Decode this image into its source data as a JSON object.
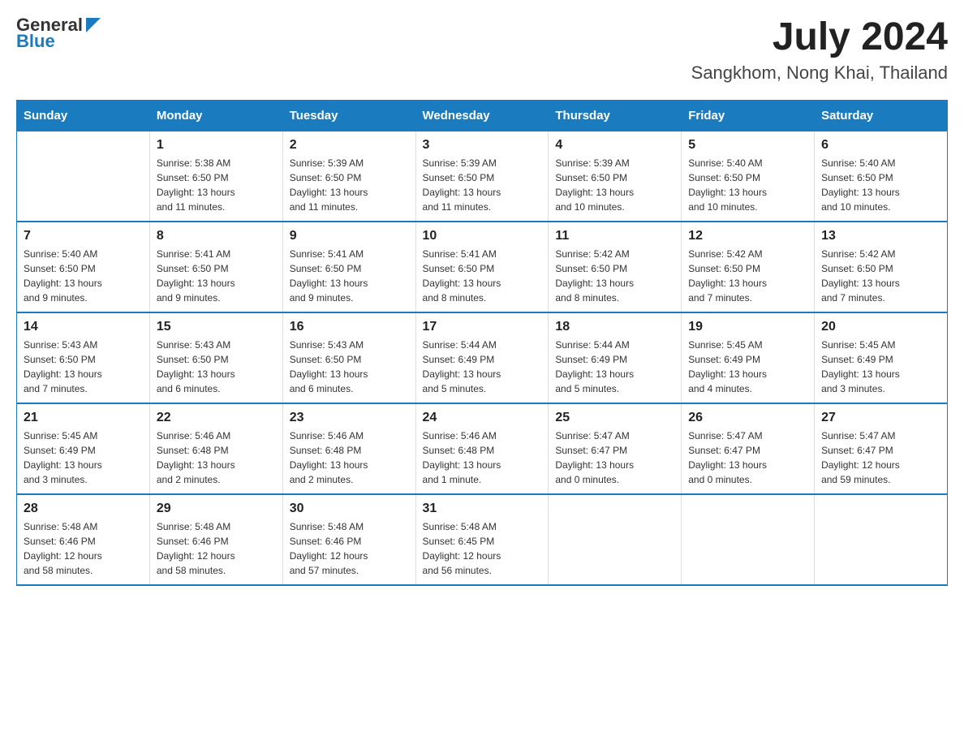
{
  "header": {
    "logo_general": "General",
    "logo_blue": "Blue",
    "title": "July 2024",
    "subtitle": "Sangkhom, Nong Khai, Thailand"
  },
  "days_of_week": [
    "Sunday",
    "Monday",
    "Tuesday",
    "Wednesday",
    "Thursday",
    "Friday",
    "Saturday"
  ],
  "weeks": [
    [
      {
        "day": "",
        "info": ""
      },
      {
        "day": "1",
        "info": "Sunrise: 5:38 AM\nSunset: 6:50 PM\nDaylight: 13 hours\nand 11 minutes."
      },
      {
        "day": "2",
        "info": "Sunrise: 5:39 AM\nSunset: 6:50 PM\nDaylight: 13 hours\nand 11 minutes."
      },
      {
        "day": "3",
        "info": "Sunrise: 5:39 AM\nSunset: 6:50 PM\nDaylight: 13 hours\nand 11 minutes."
      },
      {
        "day": "4",
        "info": "Sunrise: 5:39 AM\nSunset: 6:50 PM\nDaylight: 13 hours\nand 10 minutes."
      },
      {
        "day": "5",
        "info": "Sunrise: 5:40 AM\nSunset: 6:50 PM\nDaylight: 13 hours\nand 10 minutes."
      },
      {
        "day": "6",
        "info": "Sunrise: 5:40 AM\nSunset: 6:50 PM\nDaylight: 13 hours\nand 10 minutes."
      }
    ],
    [
      {
        "day": "7",
        "info": "Sunrise: 5:40 AM\nSunset: 6:50 PM\nDaylight: 13 hours\nand 9 minutes."
      },
      {
        "day": "8",
        "info": "Sunrise: 5:41 AM\nSunset: 6:50 PM\nDaylight: 13 hours\nand 9 minutes."
      },
      {
        "day": "9",
        "info": "Sunrise: 5:41 AM\nSunset: 6:50 PM\nDaylight: 13 hours\nand 9 minutes."
      },
      {
        "day": "10",
        "info": "Sunrise: 5:41 AM\nSunset: 6:50 PM\nDaylight: 13 hours\nand 8 minutes."
      },
      {
        "day": "11",
        "info": "Sunrise: 5:42 AM\nSunset: 6:50 PM\nDaylight: 13 hours\nand 8 minutes."
      },
      {
        "day": "12",
        "info": "Sunrise: 5:42 AM\nSunset: 6:50 PM\nDaylight: 13 hours\nand 7 minutes."
      },
      {
        "day": "13",
        "info": "Sunrise: 5:42 AM\nSunset: 6:50 PM\nDaylight: 13 hours\nand 7 minutes."
      }
    ],
    [
      {
        "day": "14",
        "info": "Sunrise: 5:43 AM\nSunset: 6:50 PM\nDaylight: 13 hours\nand 7 minutes."
      },
      {
        "day": "15",
        "info": "Sunrise: 5:43 AM\nSunset: 6:50 PM\nDaylight: 13 hours\nand 6 minutes."
      },
      {
        "day": "16",
        "info": "Sunrise: 5:43 AM\nSunset: 6:50 PM\nDaylight: 13 hours\nand 6 minutes."
      },
      {
        "day": "17",
        "info": "Sunrise: 5:44 AM\nSunset: 6:49 PM\nDaylight: 13 hours\nand 5 minutes."
      },
      {
        "day": "18",
        "info": "Sunrise: 5:44 AM\nSunset: 6:49 PM\nDaylight: 13 hours\nand 5 minutes."
      },
      {
        "day": "19",
        "info": "Sunrise: 5:45 AM\nSunset: 6:49 PM\nDaylight: 13 hours\nand 4 minutes."
      },
      {
        "day": "20",
        "info": "Sunrise: 5:45 AM\nSunset: 6:49 PM\nDaylight: 13 hours\nand 3 minutes."
      }
    ],
    [
      {
        "day": "21",
        "info": "Sunrise: 5:45 AM\nSunset: 6:49 PM\nDaylight: 13 hours\nand 3 minutes."
      },
      {
        "day": "22",
        "info": "Sunrise: 5:46 AM\nSunset: 6:48 PM\nDaylight: 13 hours\nand 2 minutes."
      },
      {
        "day": "23",
        "info": "Sunrise: 5:46 AM\nSunset: 6:48 PM\nDaylight: 13 hours\nand 2 minutes."
      },
      {
        "day": "24",
        "info": "Sunrise: 5:46 AM\nSunset: 6:48 PM\nDaylight: 13 hours\nand 1 minute."
      },
      {
        "day": "25",
        "info": "Sunrise: 5:47 AM\nSunset: 6:47 PM\nDaylight: 13 hours\nand 0 minutes."
      },
      {
        "day": "26",
        "info": "Sunrise: 5:47 AM\nSunset: 6:47 PM\nDaylight: 13 hours\nand 0 minutes."
      },
      {
        "day": "27",
        "info": "Sunrise: 5:47 AM\nSunset: 6:47 PM\nDaylight: 12 hours\nand 59 minutes."
      }
    ],
    [
      {
        "day": "28",
        "info": "Sunrise: 5:48 AM\nSunset: 6:46 PM\nDaylight: 12 hours\nand 58 minutes."
      },
      {
        "day": "29",
        "info": "Sunrise: 5:48 AM\nSunset: 6:46 PM\nDaylight: 12 hours\nand 58 minutes."
      },
      {
        "day": "30",
        "info": "Sunrise: 5:48 AM\nSunset: 6:46 PM\nDaylight: 12 hours\nand 57 minutes."
      },
      {
        "day": "31",
        "info": "Sunrise: 5:48 AM\nSunset: 6:45 PM\nDaylight: 12 hours\nand 56 minutes."
      },
      {
        "day": "",
        "info": ""
      },
      {
        "day": "",
        "info": ""
      },
      {
        "day": "",
        "info": ""
      }
    ]
  ]
}
